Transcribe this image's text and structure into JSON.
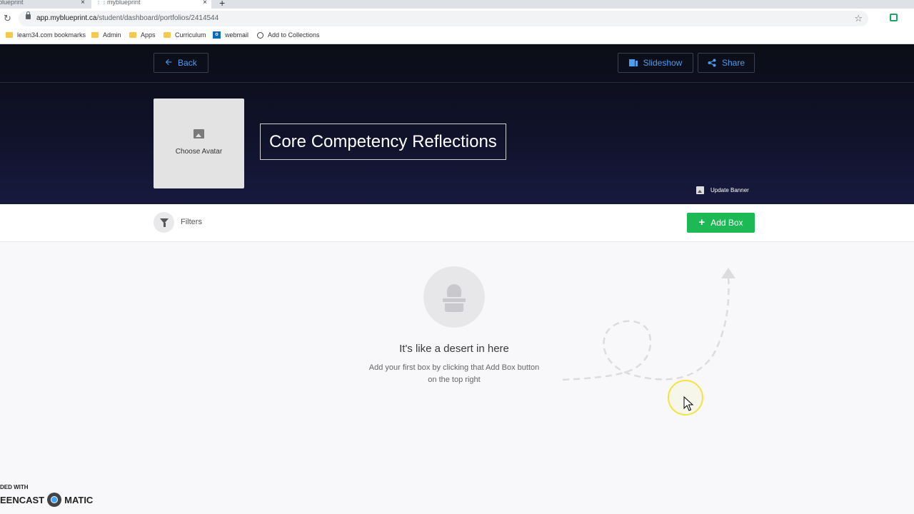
{
  "browser": {
    "tabs": [
      {
        "label": "myblueprint"
      },
      {
        "label": "myblueprint"
      }
    ],
    "close_glyph": "×",
    "new_tab_glyph": "+",
    "url_host": "app.myblueprint.ca",
    "url_path": "/student/dashboard/portfolios/2414544",
    "bookmarks": [
      {
        "label": "learn34.com bookmarks",
        "icon": "folder-icon"
      },
      {
        "label": "Admin",
        "icon": "folder-icon"
      },
      {
        "label": "Apps",
        "icon": "folder-icon"
      },
      {
        "label": "Curriculum",
        "icon": "folder-icon"
      },
      {
        "label": "webmail",
        "icon": "outlook-icon"
      },
      {
        "label": "Add to Collections",
        "icon": "globe-icon"
      }
    ]
  },
  "header": {
    "back_label": "Back",
    "slideshow_label": "Slideshow",
    "share_label": "Share",
    "avatar_label": "Choose Avatar",
    "portfolio_title": "Core Competency Reflections",
    "update_banner_label": "Update Banner"
  },
  "toolbar": {
    "filters_label": "Filters",
    "add_box_label": "Add Box"
  },
  "empty_state": {
    "title": "It's like a desert in here",
    "description_line1": "Add your first box by clicking that Add Box button",
    "description_line2": "on the top right"
  },
  "watermark": {
    "top": "DED WITH",
    "left": "EENCAST",
    "right": "MATIC"
  },
  "colors": {
    "accent_blue": "#4a9df0",
    "add_green": "#1db954",
    "header_dark": "#10122a"
  }
}
